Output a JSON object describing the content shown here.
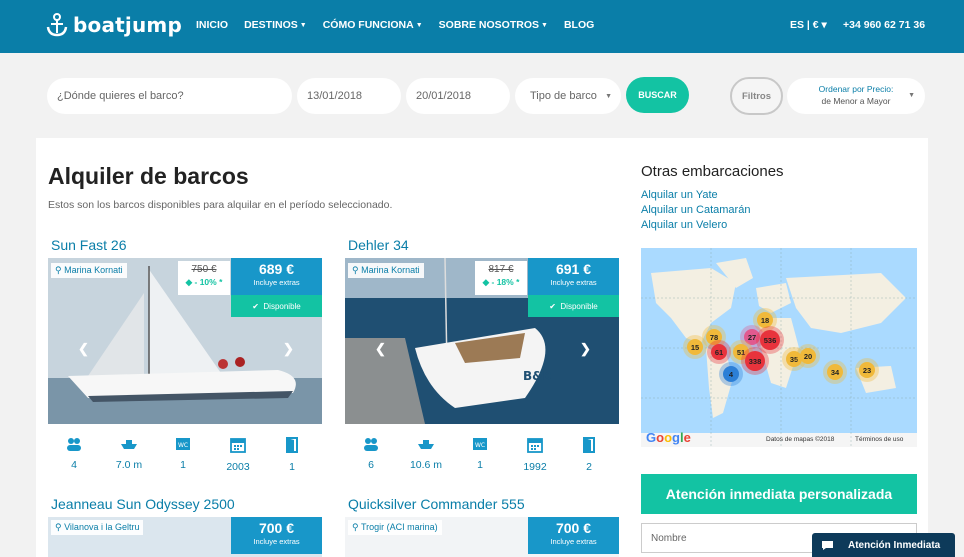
{
  "header": {
    "logo": "boatjump",
    "nav": [
      {
        "label": "INICIO",
        "dropdown": false
      },
      {
        "label": "DESTINOS",
        "dropdown": true
      },
      {
        "label": "CÓMO FUNCIONA",
        "dropdown": true
      },
      {
        "label": "SOBRE NOSOTROS",
        "dropdown": true
      },
      {
        "label": "BLOG",
        "dropdown": false
      }
    ],
    "lang": "ES | € ▾",
    "phone": "+34 960 62 71 36"
  },
  "search": {
    "where_placeholder": "¿Dónde quieres el barco?",
    "date_from": "13/01/2018",
    "date_to": "20/01/2018",
    "type": "Tipo de barco",
    "search_label": "BUSCAR",
    "filters_label": "Filtros",
    "sort_label": "Ordenar por Precio:",
    "sort_value": "de Menor a Mayor"
  },
  "main": {
    "title": "Alquiler de barcos",
    "subtitle": "Estos son los barcos disponibles para alquilar en el período seleccionado.",
    "boats": [
      {
        "name": "Sun Fast 26",
        "location": "Marina Kornati",
        "old_price": "750 €",
        "discount": "- 10% *",
        "price": "689 €",
        "includes": "Incluye extras",
        "status": "Disponible",
        "specs": {
          "people": "4",
          "length": "7.0 m",
          "wc": "1",
          "year": "2003",
          "cabins": "1"
        }
      },
      {
        "name": "Dehler 34",
        "location": "Marina Kornati",
        "old_price": "817 €",
        "discount": "- 18% *",
        "price": "691 €",
        "includes": "Incluye extras",
        "status": "Disponible",
        "specs": {
          "people": "6",
          "length": "10.6 m",
          "wc": "1",
          "year": "1992",
          "cabins": "2"
        }
      },
      {
        "name": "Jeanneau Sun Odyssey 2500",
        "location": "Vilanova i la Geltru",
        "price": "700 €",
        "includes": "Incluye extras"
      },
      {
        "name": "Quicksilver Commander 555",
        "location": "Trogir (ACI marina)",
        "price": "700 €",
        "includes": "Incluye extras"
      }
    ]
  },
  "sidebar": {
    "title": "Otras embarcaciones",
    "links": [
      "Alquilar un Yate",
      "Alquilar un Catamarán",
      "Alquilar un Velero"
    ],
    "map": {
      "clusters": [
        "18",
        "78",
        "15",
        "27",
        "536",
        "51",
        "61",
        "338",
        "35",
        "20",
        "4",
        "34",
        "23"
      ],
      "copyright": "Datos de mapas ©2018",
      "terms": "Términos de uso",
      "brand": "Google"
    },
    "attention_title": "Atención inmediata personalizada",
    "name_placeholder": "Nombre"
  },
  "chat": {
    "label": "Atención Inmediata"
  },
  "colors": {
    "header": "#0a7ea8",
    "accent": "#13c3a3",
    "price": "#1897c9"
  }
}
